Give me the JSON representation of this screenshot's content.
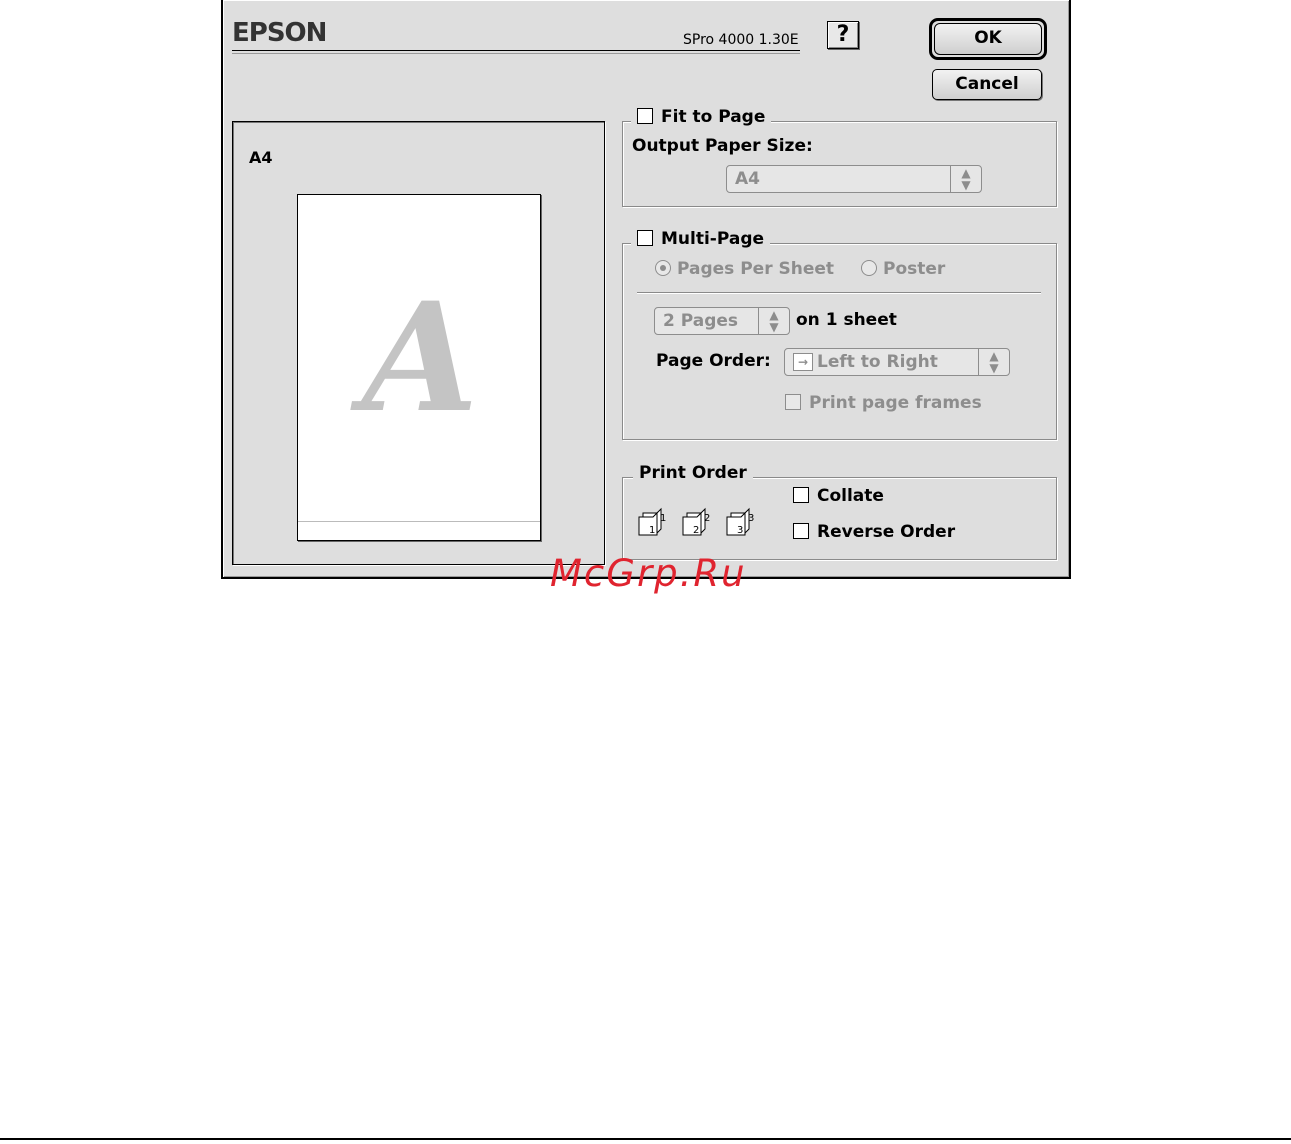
{
  "header": {
    "brand": "EPSON",
    "version": "SPro 4000 1.30E",
    "help_label": "?",
    "ok_label": "OK",
    "cancel_label": "Cancel"
  },
  "preview": {
    "paper_label": "A4",
    "glyph": "A"
  },
  "fit_to_page": {
    "checkbox_label": "Fit to Page",
    "checked": false,
    "output_size_label": "Output Paper Size:",
    "output_size_value": "A4"
  },
  "multi_page": {
    "checkbox_label": "Multi-Page",
    "checked": false,
    "radio_pages_per_sheet": "Pages Per Sheet",
    "radio_poster": "Poster",
    "selected_radio": "Pages Per Sheet",
    "pages_value": "2 Pages",
    "pages_suffix": "on 1 sheet",
    "page_order_label": "Page Order:",
    "page_order_icon": "→",
    "page_order_value": "Left to Right",
    "print_frames_label": "Print page frames",
    "print_frames_checked": false
  },
  "print_order": {
    "legend": "Print Order",
    "stack_icons": [
      "1",
      "2",
      "3"
    ],
    "collate_label": "Collate",
    "collate_checked": false,
    "reverse_label": "Reverse Order",
    "reverse_checked": false
  },
  "watermark": "McGrp.Ru"
}
